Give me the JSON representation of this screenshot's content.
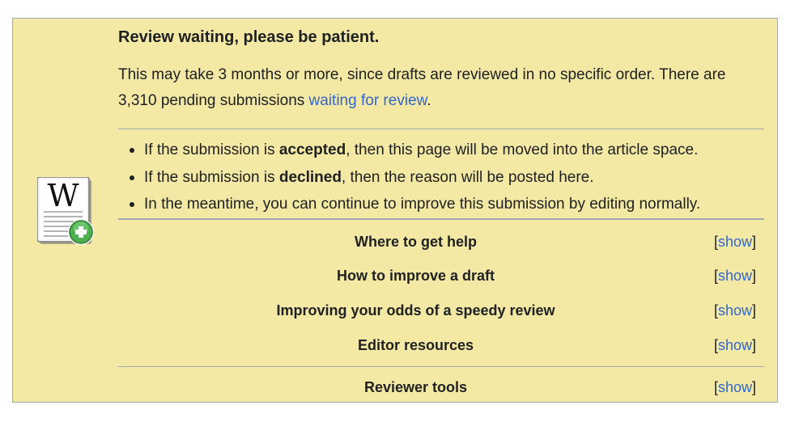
{
  "notice": {
    "title": "Review waiting, please be patient.",
    "para_before": "This may take 3 months or more, since drafts are reviewed in no specific order. There are 3,310 pending submissions ",
    "para_link": "waiting for review",
    "para_after": ".",
    "icon": "wikipedia-draft-add-icon",
    "bullets": [
      {
        "before": "If the submission is ",
        "bold": "accepted",
        "after": ", then this page will be moved into the article space."
      },
      {
        "before": "If the submission is ",
        "bold": "declined",
        "after": ", then the reason will be posted here."
      },
      {
        "before": "In the meantime, you can continue to improve this submission by editing normally.",
        "bold": "",
        "after": ""
      }
    ],
    "sections": [
      {
        "label": "Where to get help",
        "toggle": "show"
      },
      {
        "label": "How to improve a draft",
        "toggle": "show"
      },
      {
        "label": "Improving your odds of a speedy review",
        "toggle": "show"
      },
      {
        "label": "Editor resources",
        "toggle": "show"
      }
    ],
    "reviewer": {
      "label": "Reviewer tools",
      "toggle": "show"
    },
    "colors": {
      "background": "#f3e8a4",
      "border": "#a2a9b1",
      "link": "#3366cc",
      "text": "#202122"
    }
  }
}
